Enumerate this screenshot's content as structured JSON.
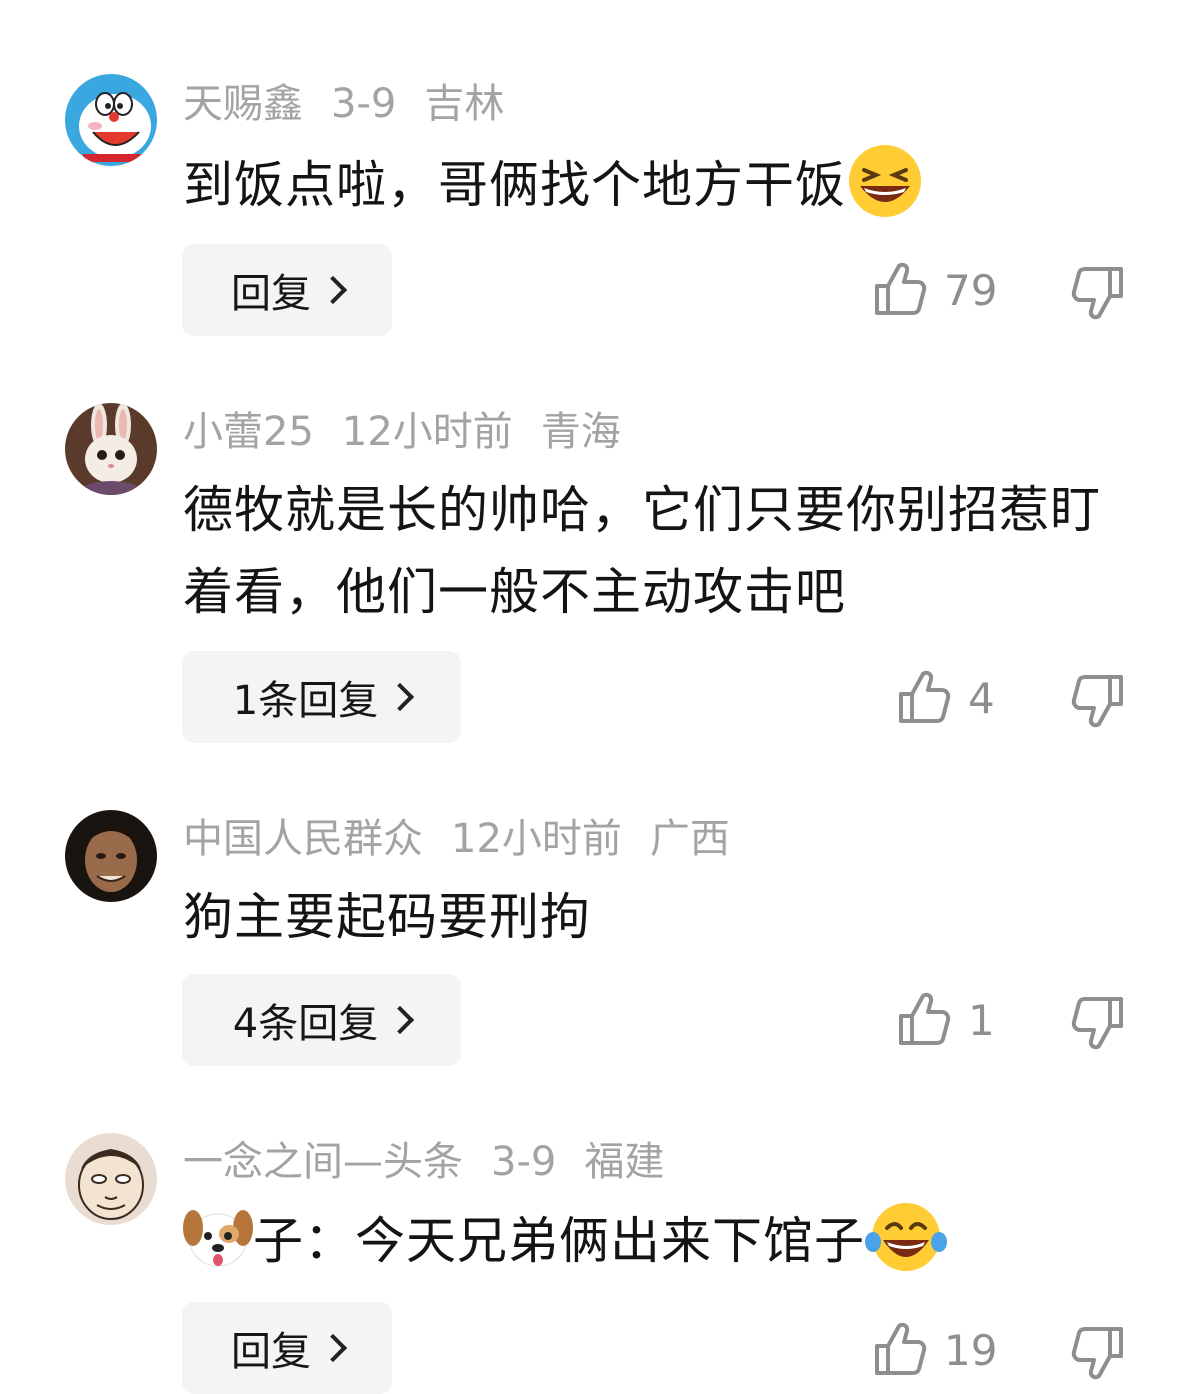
{
  "comments": [
    {
      "username": "天赐鑫",
      "time": "3-9",
      "location": "吉林",
      "text": "到饭点啦，哥俩找个地方干饭",
      "text_prefix_emoji": "",
      "text_suffix_emoji": "grinning-squint-emoji",
      "reply_label": "回复",
      "likes": "79",
      "avatar": "doraemon-avatar"
    },
    {
      "username": "小蕾25",
      "time": "12小时前",
      "location": "青海",
      "text": "德牧就是长的帅哈，它们只要你别招惹盯着看，他们一般不主动攻击吧",
      "text_prefix_emoji": "",
      "text_suffix_emoji": "",
      "reply_label": "1条回复",
      "likes": "4",
      "avatar": "rabbit-avatar"
    },
    {
      "username": "中国人民群众",
      "time": "12小时前",
      "location": "广西",
      "text": "狗主要起码要刑拘",
      "text_prefix_emoji": "",
      "text_suffix_emoji": "",
      "reply_label": "4条回复",
      "likes": "1",
      "avatar": "man-portrait-avatar"
    },
    {
      "username": "一念之间—头条",
      "time": "3-9",
      "location": "福建",
      "text": "子：今天兄弟俩出来下馆子",
      "text_prefix_emoji": "dog-face-emoji",
      "text_suffix_emoji": "tears-of-joy-emoji",
      "reply_label": "回复",
      "likes": "19",
      "avatar": "cartoon-face-avatar"
    }
  ],
  "colors": {
    "meta": "#a3a3a3",
    "text": "#141414",
    "reply_bg": "#f4f4f4",
    "icon": "#8e8e8e"
  }
}
